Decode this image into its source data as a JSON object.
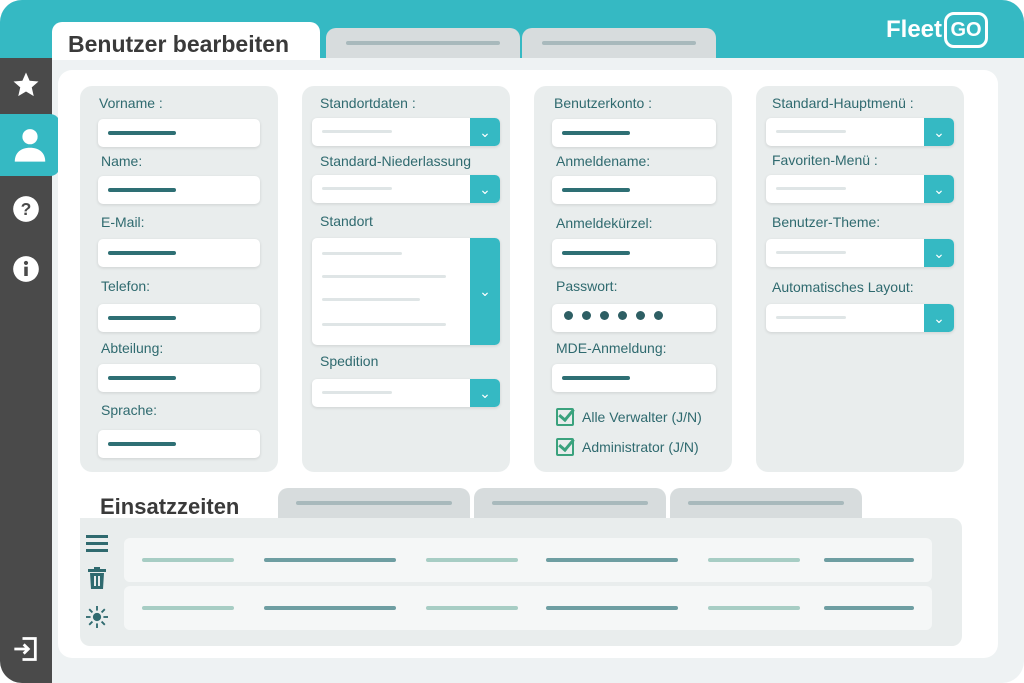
{
  "app": {
    "logo_fleet": "Fleet",
    "logo_go": "GO",
    "active_tab": "Benutzer bearbeiten",
    "inactive_tab_count": 2
  },
  "sidebar": {
    "items": [
      {
        "icon": "star-icon"
      },
      {
        "icon": "user-icon",
        "active": true
      },
      {
        "icon": "help-icon"
      },
      {
        "icon": "info-icon"
      },
      {
        "icon": "logout-icon"
      }
    ]
  },
  "personal": {
    "vorname_label": "Vorname :",
    "name_label": "Name:",
    "email_label": "E-Mail:",
    "telefon_label": "Telefon:",
    "abteilung_label": "Abteilung:",
    "sprache_label": "Sprache:"
  },
  "location": {
    "standortdaten_label": "Standortdaten :",
    "niederlassung_label": "Standard-Niederlassung",
    "standort_label": "Standort",
    "spedition_label": "Spedition"
  },
  "account": {
    "benutzerkonto_label": "Benutzerkonto :",
    "anmeldename_label": "Anmeldename:",
    "anmeldekuerzel_label": "Anmeldekürzel:",
    "passwort_label": "Passwort:",
    "mde_label": "MDE-Anmeldung:",
    "alle_verwalter_label": "Alle Verwalter (J/N)",
    "alle_verwalter_checked": true,
    "administrator_label": "Administrator (J/N)",
    "administrator_checked": true
  },
  "preferences": {
    "hauptmenue_label": "Standard-Hauptmenü :",
    "favoriten_label": "Favoriten-Menü :",
    "theme_label": "Benutzer-Theme:",
    "layout_label": "Automatisches Layout:"
  },
  "schedule": {
    "active_tab": "Einsatzzeiten",
    "inactive_tab_count": 3,
    "tools": [
      "menu-icon",
      "trash-icon",
      "sun-icon"
    ],
    "row_count": 2
  },
  "colors": {
    "accent": "#35b9c3",
    "sidebar": "#4a4a4a",
    "label_text": "#2f6a6f",
    "check_green": "#3aa27d"
  }
}
